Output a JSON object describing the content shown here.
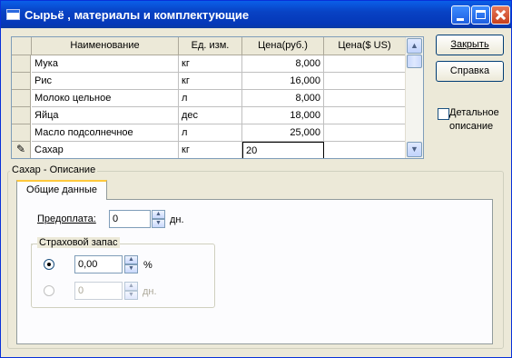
{
  "window": {
    "title": "Сырьё , материалы и комплектующие"
  },
  "grid": {
    "columns": [
      "Наименование",
      "Ед. изм.",
      "Цена(руб.)",
      "Цена($ US)"
    ],
    "rows": [
      {
        "name": "Мука",
        "unit": "кг",
        "price_rub": "8,000",
        "price_usd": ""
      },
      {
        "name": "Рис",
        "unit": "кг",
        "price_rub": "16,000",
        "price_usd": ""
      },
      {
        "name": "Молоко цельное",
        "unit": "л",
        "price_rub": "8,000",
        "price_usd": ""
      },
      {
        "name": "Яйца",
        "unit": "дес",
        "price_rub": "18,000",
        "price_usd": ""
      },
      {
        "name": "Масло подсолнечное",
        "unit": "л",
        "price_rub": "25,000",
        "price_usd": ""
      },
      {
        "name": "Сахар",
        "unit": "кг",
        "price_rub": "20",
        "price_usd": ""
      }
    ],
    "edit_indicator": "✎"
  },
  "buttons": {
    "close": "Закрыть",
    "help": "Справка"
  },
  "detail": {
    "label": "Детальное описание",
    "checked": false
  },
  "description": {
    "group_title": "Сахар - Описание",
    "tab_label": "Общие данные",
    "prepayment": {
      "label": "Предоплата:",
      "value": "0",
      "unit": "дн."
    },
    "stock": {
      "title": "Страховой запас",
      "percent": {
        "value": "0,00",
        "unit": "%",
        "selected": true
      },
      "days": {
        "value": "0",
        "unit": "дн.",
        "selected": false
      }
    }
  },
  "icons": {
    "up": "▲",
    "down": "▼"
  }
}
